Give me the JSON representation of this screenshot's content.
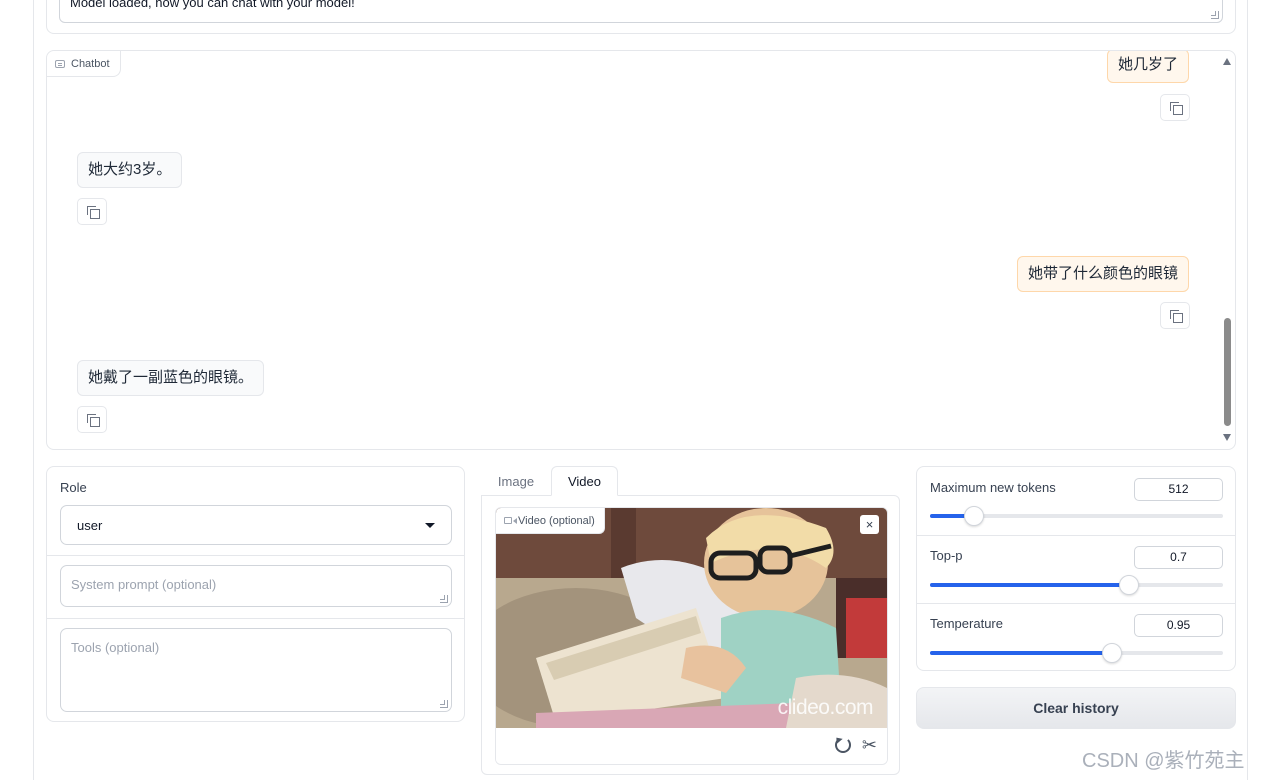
{
  "status": {
    "text": "Model loaded, now you can chat with your model!"
  },
  "chatbot": {
    "label": "Chatbot",
    "messages": [
      {
        "role": "user",
        "text": "她几岁了"
      },
      {
        "role": "bot",
        "text": "她大约3岁。"
      },
      {
        "role": "user",
        "text": "她带了什么颜色的眼镜"
      },
      {
        "role": "bot",
        "text": "她戴了一副蓝色的眼镜。"
      }
    ]
  },
  "inputs": {
    "role_label": "Role",
    "role_value": "user",
    "system_prompt_placeholder": "System prompt (optional)",
    "tools_placeholder": "Tools (optional)"
  },
  "media": {
    "tabs": [
      "Image",
      "Video"
    ],
    "active_tab": "Video",
    "video_label": "Video (optional)",
    "close_glyph": "×",
    "watermark": "clideo.com"
  },
  "params": {
    "max_tokens": {
      "label": "Maximum new tokens",
      "value": "512",
      "fraction": 0.15
    },
    "top_p": {
      "label": "Top-p",
      "value": "0.7",
      "fraction": 0.68
    },
    "temperature": {
      "label": "Temperature",
      "value": "0.95",
      "fraction": 0.62
    }
  },
  "buttons": {
    "clear_history": "Clear history"
  },
  "overlay": {
    "csdn_watermark": "CSDN @紫竹苑主"
  },
  "colors": {
    "accent": "#2563eb",
    "user_bubble": "#fff7ed",
    "bot_bubble": "#f9fafb"
  }
}
